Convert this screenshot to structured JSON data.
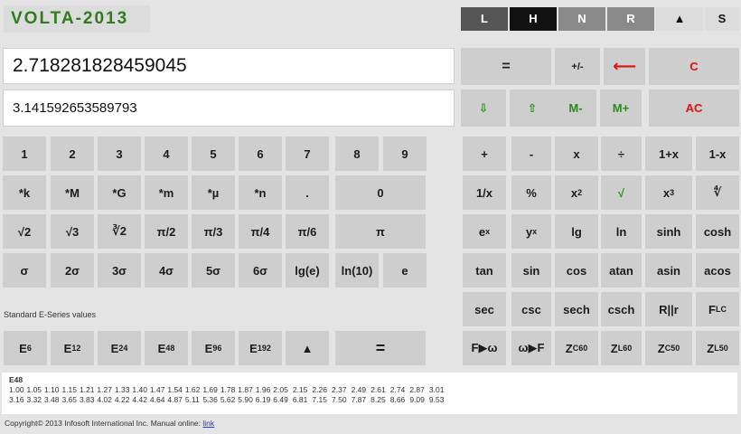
{
  "app": {
    "title": "VOLTA-2013"
  },
  "modes": [
    {
      "label": "L",
      "color": "#555555"
    },
    {
      "label": "H",
      "color": "#111111"
    },
    {
      "label": "N",
      "color": "#8a8a8a"
    },
    {
      "label": "R",
      "color": "#8a8a8a"
    },
    {
      "label": "▲",
      "color": "#dcdcdc"
    },
    {
      "label": "S",
      "color": "#dcdcdc"
    }
  ],
  "display": {
    "primary": "2.718281828459045",
    "secondary": "3.141592653589793"
  },
  "control": {
    "row1": [
      "=",
      "+/-",
      "⟵",
      "C"
    ],
    "row2": [
      "⇩",
      "⇧",
      "M-",
      "M+",
      "AC"
    ]
  },
  "numpad": {
    "row1": [
      "1",
      "2",
      "3",
      "4",
      "5",
      "6",
      "7",
      "8",
      "9"
    ],
    "row2": [
      "*k",
      "*M",
      "*G",
      "*m",
      "*µ",
      "*n",
      ".",
      "0"
    ],
    "row3": [
      "√2",
      "√3",
      "∛2",
      "π/2",
      "π/3",
      "π/4",
      "π/6",
      "π"
    ],
    "row4": [
      "σ",
      "2σ",
      "3σ",
      "4σ",
      "5σ",
      "6σ",
      "lg(e)",
      "ln(10)",
      "e"
    ]
  },
  "functions": {
    "row1": [
      "+",
      "-",
      "x",
      "÷",
      "1+x",
      "1-x"
    ],
    "row2": [
      "1/x",
      "%",
      "x",
      "√",
      "x",
      "∜"
    ],
    "row2_sup": [
      "",
      "",
      "2",
      "",
      "3",
      ""
    ],
    "row3": [
      "e",
      "y",
      "lg",
      "ln",
      "sinh",
      "cosh"
    ],
    "row3_sup": [
      "x",
      "x",
      "",
      "",
      "",
      ""
    ],
    "row4": [
      "tan",
      "sin",
      "cos",
      "atan",
      "asin",
      "acos"
    ],
    "row5": [
      "sec",
      "csc",
      "sech",
      "csch",
      "R||r",
      "F"
    ],
    "row5_sub": [
      "",
      "",
      "",
      "",
      "",
      "LC"
    ],
    "row6": [
      "F▶ω",
      "ω▶F",
      "Z",
      "Z",
      "Z",
      "Z"
    ],
    "row6_sub": [
      "",
      "",
      "C",
      "L",
      "C",
      "L"
    ],
    "row6_sup": [
      "",
      "",
      "60",
      "60",
      "50",
      "50"
    ]
  },
  "eseries_note": "Standard E-Series values",
  "eseries_buttons": {
    "base": "E",
    "subs": [
      "6",
      "12",
      "24",
      "48",
      "96",
      "192"
    ],
    "up": "▲",
    "eq": "="
  },
  "eseries_table": {
    "label": "E48",
    "row1": [
      "1.00",
      "1.05",
      "1.10",
      "1.15",
      "1.21",
      "1.27",
      "1.33",
      "1.40",
      "1.47",
      "1.54",
      "1.62",
      "1.69",
      "1.78",
      "1.87",
      "1.96",
      "2.05",
      "2.15",
      "2.26",
      "2.37",
      "2.49",
      "2.61",
      "2.74",
      "2.87",
      "3.01"
    ],
    "row2": [
      "3.16",
      "3.32",
      "3.48",
      "3.65",
      "3.83",
      "4.02",
      "4.22",
      "4.42",
      "4.64",
      "4.87",
      "5.11",
      "5.36",
      "5.62",
      "5.90",
      "6.19",
      "6.49",
      "6.81",
      "7.15",
      "7.50",
      "7.87",
      "8.25",
      "8.66",
      "9.09",
      "9.53"
    ]
  },
  "footer": {
    "text": "Copyright© 2013 Infosoft International Inc. Manual online: ",
    "link": "link"
  }
}
